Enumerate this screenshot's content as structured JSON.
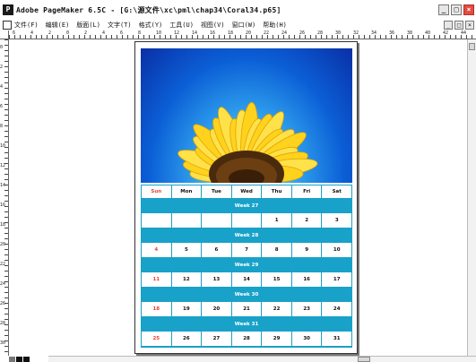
{
  "window": {
    "title": "Adobe PageMaker 6.5C - [G:\\源文件\\xc\\pml\\chap34\\Coral34.p65]",
    "controls": [
      "_",
      "□",
      "×"
    ]
  },
  "menu": {
    "items": [
      "文件(F)",
      "编辑(E)",
      "版面(L)",
      "文字(T)",
      "格式(Y)",
      "工具(U)",
      "视图(V)",
      "窗口(W)",
      "帮助(H)"
    ],
    "doc_controls": [
      "_",
      "□",
      "×"
    ]
  },
  "ruler": {
    "h_labels": [
      "6",
      "4",
      "2",
      "0",
      "2",
      "4",
      "6",
      "8",
      "10",
      "12",
      "14",
      "16",
      "18",
      "20",
      "22",
      "24",
      "26",
      "28",
      "30",
      "32",
      "34",
      "36",
      "38",
      "40",
      "42",
      "44"
    ],
    "v_labels": [
      "0",
      "2",
      "4",
      "6",
      "8",
      "10",
      "12",
      "14",
      "16",
      "18",
      "20",
      "22",
      "24",
      "26",
      "28",
      "30"
    ]
  },
  "calendar": {
    "day_headers": [
      "Sun",
      "Mon",
      "Tue",
      "Wed",
      "Thu",
      "Fri",
      "Sat"
    ],
    "weeks": [
      {
        "label": "Week 27",
        "days": [
          "",
          "",
          "",
          "",
          "1",
          "2",
          "3"
        ]
      },
      {
        "label": "Week 28",
        "days": [
          "4",
          "5",
          "6",
          "7",
          "8",
          "9",
          "10"
        ]
      },
      {
        "label": "Week 29",
        "days": [
          "11",
          "12",
          "13",
          "14",
          "15",
          "16",
          "17"
        ]
      },
      {
        "label": "Week 30",
        "days": [
          "18",
          "19",
          "20",
          "21",
          "22",
          "23",
          "24"
        ]
      },
      {
        "label": "Week 31",
        "days": [
          "25",
          "26",
          "27",
          "28",
          "29",
          "30",
          "31"
        ]
      }
    ]
  },
  "colors": {
    "band": "#19a2c9",
    "sunday": "#e8432f",
    "sky_top": "#0a2fa6",
    "sky_glow": "#8ee9ff",
    "petal": "#ffd21e",
    "petal_dark": "#e0a400",
    "seed": "#4a2a0c"
  }
}
